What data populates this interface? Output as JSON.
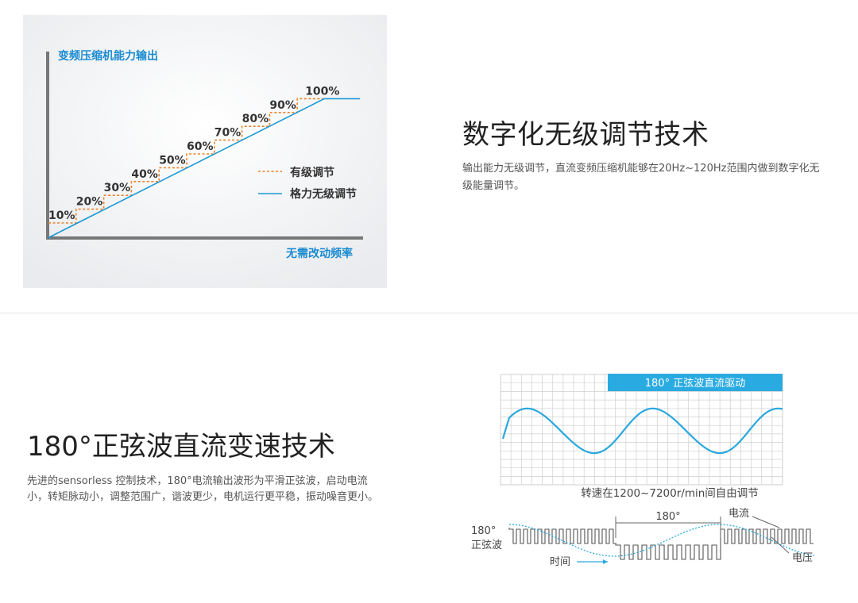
{
  "section1": {
    "title": "数字化无级调节技术",
    "description": "输出能力无级调节，直流变频压缩机能够在20Hz~120Hz范围内做到数字化无级能量调节。",
    "figure": {
      "ylabel": "变频压缩机能力输出",
      "xlabel": "无需改动频率",
      "legend_step": "有级调节",
      "legend_linear": "格力无级调节",
      "step_labels": [
        "10%",
        "20%",
        "30%",
        "40%",
        "50%",
        "60%",
        "70%",
        "80%",
        "90%",
        "100%"
      ],
      "colors": {
        "axis": "#777777",
        "step_line": "#e8842c",
        "linear_line": "#1a9ad6",
        "label_blue": "#1a8bd1"
      }
    }
  },
  "section2": {
    "title": "180°正弦波直流变速技术",
    "description": "先进的sensorless 控制技术，180°电流输出波形为平滑正弦波，启动电流小，转矩脉动小，调整范围广，谐波更少，电机运行更平稳，振动噪音更小。",
    "figure": {
      "banner": "180° 正弦波直流驱动",
      "caption": "转速在1200~7200r/min间自由调节",
      "angle_label": "180°",
      "current_label": "电流",
      "sine_label_line1": "180°",
      "sine_label_line2": "正弦波",
      "time_label": "时间",
      "voltage_label": "电压",
      "colors": {
        "wave": "#2aa8df",
        "banner_bg": "#29abe2",
        "grid": "#cfcfcf",
        "pulse": "#555555"
      }
    }
  }
}
